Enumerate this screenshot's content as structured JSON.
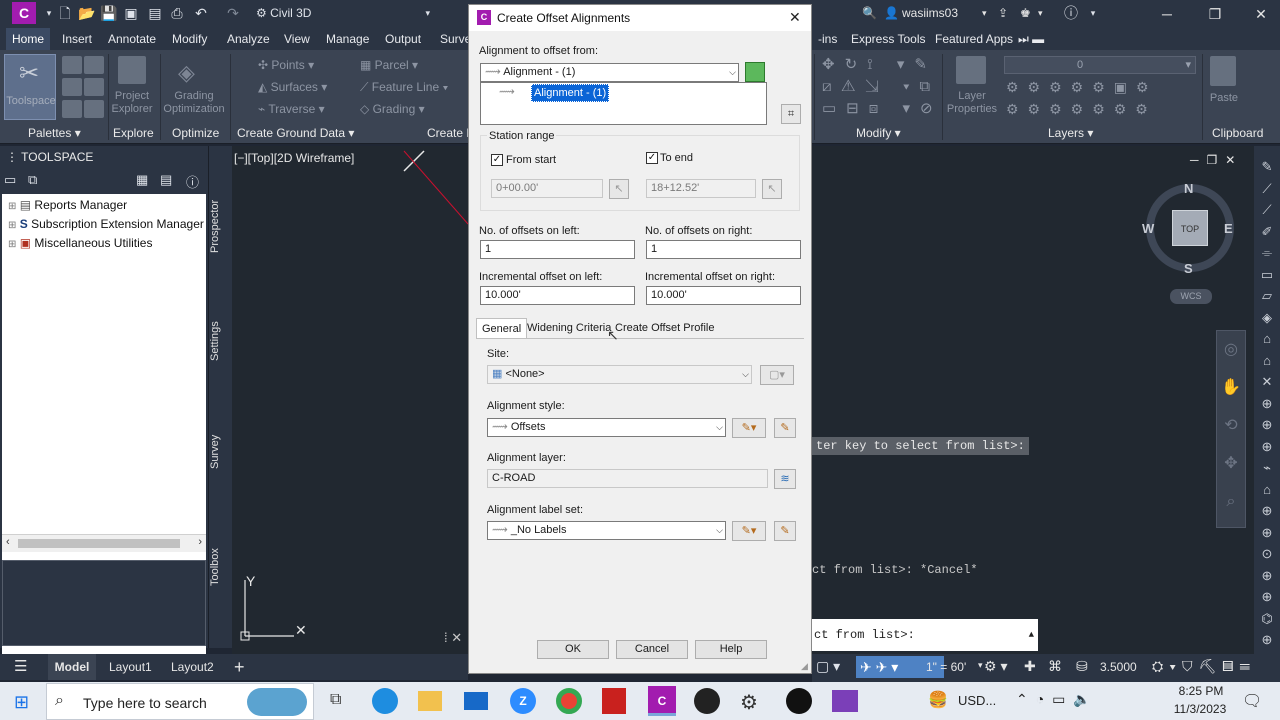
{
  "window": {
    "workspace": "Civil 3D",
    "user": "wasiims03",
    "quick_access_icons": [
      "new-icon",
      "open-icon",
      "save-icon",
      "save-as-icon",
      "web-icon",
      "plot-icon",
      "undo-icon",
      "redo-icon"
    ]
  },
  "ribbon": {
    "tabs": [
      "Home",
      "Insert",
      "Annotate",
      "Modify",
      "Analyze",
      "View",
      "Manage",
      "Output",
      "Surve",
      "-ins",
      "Express Tools",
      "Featured Apps"
    ],
    "active_tab": "Home",
    "panels": [
      "Palettes",
      "Explore",
      "Optimize",
      "Create Ground Data",
      "Create D",
      "Modify",
      "Layers",
      "Clipboard"
    ],
    "toolspace_label": "Toolspace",
    "project_explorer": "Project Explorer",
    "grading_optimization": "Grading Optimization",
    "points": "Points",
    "surfaces": "Surfaces",
    "traverse": "Traverse",
    "parcel": "Parcel",
    "feature_line": "Feature Line",
    "grading": "Grading",
    "layer_properties": "Layer Properties",
    "paste": "Paste",
    "layer_value": "0"
  },
  "toolspace": {
    "title": "TOOLSPACE",
    "items": [
      "Reports Manager",
      "Subscription Extension Manager",
      "Miscellaneous Utilities"
    ],
    "side_tabs": [
      "Prospector",
      "Settings",
      "Survey",
      "Toolbox"
    ]
  },
  "viewport": {
    "label": "[−][Top][2D Wireframe]",
    "compass": {
      "n": "N",
      "s": "S",
      "e": "E",
      "w": "W",
      "top": "TOP",
      "wcs": "WCS"
    },
    "cmd_prompt_1": "ter key to select from list>:",
    "cmd_history": "ct from list>: *Cancel*",
    "cmd_input": "ct from list>:"
  },
  "layout_tabs": {
    "model": "Model",
    "layout1": "Layout1",
    "layout2": "Layout2",
    "add": "+"
  },
  "status": {
    "scale": "1\" = 60'",
    "value": "3.5000"
  },
  "taskbar": {
    "search_placeholder": "Type here to search",
    "currency": "USD...",
    "time": "8:25 PM",
    "date": "11/3/2023"
  },
  "dialog": {
    "title": "Create Offset Alignments",
    "align_from_label": "Alignment to offset from:",
    "align_from_value": "Alignment - (1)",
    "list_item": "Alignment - (1)",
    "station_range_label": "Station range",
    "from_start_label": "From start",
    "from_start_checked": true,
    "to_end_label": "To end",
    "to_end_checked": true,
    "start_station": "0+00.00'",
    "end_station": "18+12.52'",
    "offsets_left_label": "No. of offsets on left:",
    "offsets_left": "1",
    "offsets_right_label": "No. of offsets on right:",
    "offsets_right": "1",
    "incr_left_label": "Incremental offset on left:",
    "incr_left": "10.000'",
    "incr_right_label": "Incremental offset on right:",
    "incr_right": "10.000'",
    "tabs": [
      "General",
      "Widening Criteria",
      "Create Offset Profile"
    ],
    "active_tab": "General",
    "site_label": "Site:",
    "site_value": "<None>",
    "align_style_label": "Alignment style:",
    "align_style_value": "Offsets",
    "align_layer_label": "Alignment layer:",
    "align_layer_value": "C-ROAD",
    "label_set_label": "Alignment label set:",
    "label_set_value": "_No Labels",
    "ok": "OK",
    "cancel": "Cancel",
    "help": "Help"
  }
}
